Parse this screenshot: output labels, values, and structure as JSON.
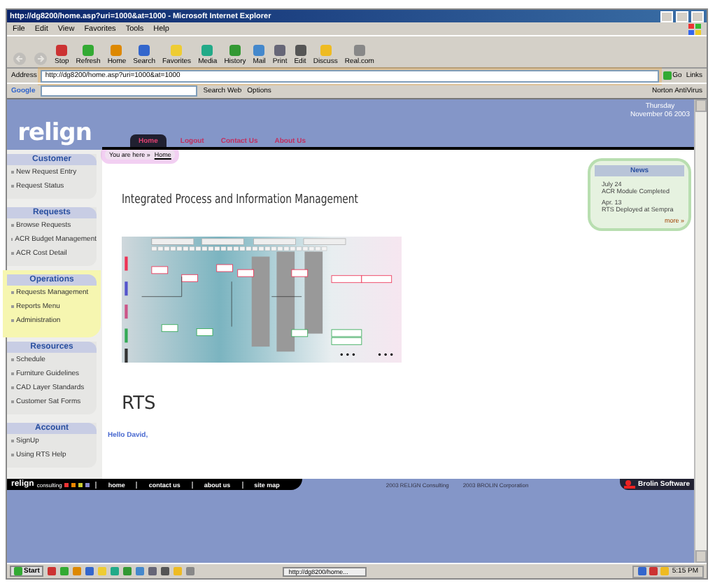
{
  "window": {
    "title": "http://dg8200/home.asp?uri=1000&at=1000 - Microsoft Internet Explorer"
  },
  "menu": [
    "File",
    "Edit",
    "View",
    "Favorites",
    "Tools",
    "Help"
  ],
  "nav_buttons": [
    {
      "disabled": true
    },
    {
      "disabled": true
    }
  ],
  "toolbar": [
    "Stop",
    "Refresh",
    "Home",
    "Search",
    "Favorites",
    "Media",
    "History",
    "Mail",
    "Print",
    "Edit",
    "Discuss",
    "Real.com"
  ],
  "address": {
    "label": "Address",
    "value": "http://dg8200/home.asp?uri=1000&at=1000",
    "go": "Go",
    "links": "Links"
  },
  "google_bar": {
    "logo": "Google",
    "search": "Search Web",
    "options": "Options",
    "antivirus": "Norton AntiVirus"
  },
  "site": {
    "logo": "relign",
    "date": [
      "Thursday",
      "November 06 2003"
    ],
    "tabs": [
      {
        "label": "Home",
        "selected": true
      },
      {
        "label": "Logout",
        "selected": false
      },
      {
        "label": "Contact Us",
        "selected": false
      },
      {
        "label": "About Us",
        "selected": false
      }
    ],
    "breadcrumb": {
      "label": "You are here »",
      "link": "Home"
    },
    "sidebar": [
      {
        "title": "Customer",
        "highlighted": false,
        "items": [
          "New Request Entry",
          "Request Status"
        ]
      },
      {
        "title": "Requests",
        "highlighted": false,
        "items": [
          "Browse Requests",
          "ACR Budget Management",
          "ACR Cost Detail"
        ]
      },
      {
        "title": "Operations",
        "highlighted": true,
        "items": [
          "Requests Management",
          "Reports Menu",
          "Administration"
        ]
      },
      {
        "title": "Resources",
        "highlighted": false,
        "items": [
          "Schedule",
          "Furniture Guidelines",
          "CAD Layer Standards",
          "Customer Sat Forms"
        ]
      },
      {
        "title": "Account",
        "highlighted": false,
        "items": [
          "SignUp",
          "Using RTS Help"
        ]
      }
    ],
    "heading": "Integrated Process and Information Management",
    "subheading": "RTS",
    "greeting": "Hello David,",
    "news": {
      "title": "News",
      "items": [
        {
          "date": "July 24",
          "text": "ACR Module Completed"
        },
        {
          "date": "Apr. 13",
          "text": "RTS Deployed at Sempra"
        }
      ],
      "more": "more »"
    },
    "footer": {
      "logo": "relign",
      "logo_sub": "consulting",
      "links": [
        "home",
        "contact us",
        "about us",
        "site map"
      ],
      "copyrights": [
        "2003 RELIGN Consulting",
        "2003 BROLIN Corporation"
      ],
      "powered": "Brolin Software"
    }
  },
  "taskbar": {
    "start": "Start",
    "task": "http://dg8200/home...",
    "time": "5:15 PM"
  }
}
